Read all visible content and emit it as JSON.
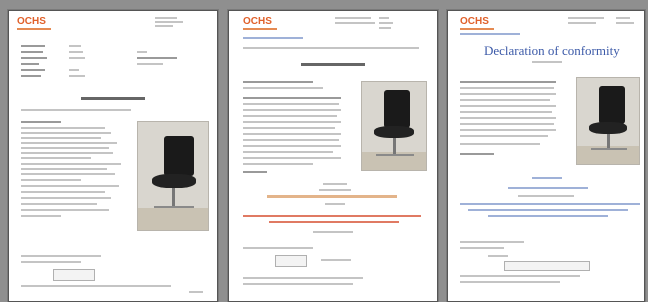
{
  "brand": {
    "logo_text": "OCHS",
    "accent": "#e0602a"
  },
  "pages": [
    {
      "title": ""
    },
    {
      "title": ""
    },
    {
      "title": "Declaration of conformity"
    }
  ]
}
